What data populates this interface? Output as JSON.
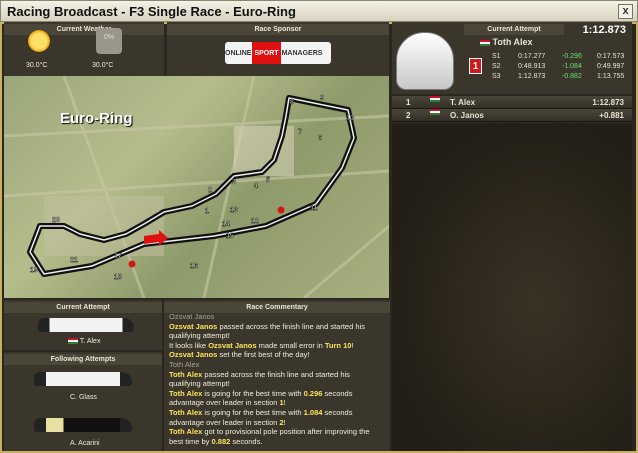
{
  "window": {
    "title": "Racing Broadcast - F3 Single Race - Euro-Ring",
    "close_label": "x"
  },
  "weather": {
    "header": "Current Weather",
    "now_temp": "30.0°C",
    "forecast_pct": "0%",
    "forecast_temp": "30.0°C"
  },
  "sponsor": {
    "header": "Race Sponsor",
    "logo_left": "ONLINE",
    "logo_mid": "SPORT",
    "logo_right": "MANAGERS"
  },
  "map": {
    "track_name": "Euro-Ring",
    "corners": [
      "1",
      "2",
      "3",
      "4",
      "5",
      "6",
      "7",
      "8",
      "9",
      "10",
      "11",
      "12",
      "13",
      "14",
      "15",
      "16",
      "17",
      "18",
      "19",
      "20",
      "21"
    ]
  },
  "current_attempt": {
    "header": "Current Attempt",
    "driver": "Toth Alex",
    "position": "1",
    "time": "1:12.873",
    "sectors": [
      {
        "label": "S1",
        "time": "0:17.277",
        "delta": "-0.296",
        "best": "0:17.573"
      },
      {
        "label": "S2",
        "time": "0:48.913",
        "delta": "-1.084",
        "best": "0:49.997"
      },
      {
        "label": "S3",
        "time": "1:12.873",
        "delta": "-0.882",
        "best": "1:13.755"
      }
    ]
  },
  "standings": [
    {
      "pos": "1",
      "driver": "T. Alex",
      "time": "1:12.873"
    },
    {
      "pos": "2",
      "driver": "O. Janos",
      "time": "+0.881"
    }
  ],
  "current_attempt_small": {
    "header": "Current Attempt",
    "driver": "T. Alex"
  },
  "following": {
    "header": "Following Attempts",
    "drivers": [
      "C. Glass",
      "A. Acarini"
    ]
  },
  "commentary": {
    "header": "Race Commentary",
    "lines": [
      {
        "cls": "hdr",
        "text": "Ozsvat Janos"
      },
      {
        "parts": [
          {
            "hl": "Ozsvat Janos"
          },
          {
            "t": " passed across the finish line and started his qualifying attempt!"
          }
        ]
      },
      {
        "parts": [
          {
            "t": "It looks like "
          },
          {
            "hl": "Ozsvat Janos"
          },
          {
            "t": " made small error in "
          },
          {
            "hl": "Turn 10"
          },
          {
            "t": "!"
          }
        ]
      },
      {
        "parts": [
          {
            "hl": "Ozsvat Janos"
          },
          {
            "t": " set the first best of the day!"
          }
        ]
      },
      {
        "cls": "hdr",
        "text": "Toth Alex"
      },
      {
        "parts": [
          {
            "hl": "Toth Alex"
          },
          {
            "t": " passed across the finish line and started his qualifying attempt!"
          }
        ]
      },
      {
        "parts": [
          {
            "hl": "Toth Alex"
          },
          {
            "t": " is going for the best time with "
          },
          {
            "hl": "0.296"
          },
          {
            "t": " seconds advantage over leader in section "
          },
          {
            "hl": "1"
          },
          {
            "t": "!"
          }
        ]
      },
      {
        "parts": [
          {
            "hl": "Toth Alex"
          },
          {
            "t": " is going for the best time with "
          },
          {
            "hl": "1.084"
          },
          {
            "t": " seconds advantage over leader in section "
          },
          {
            "hl": "2"
          },
          {
            "t": "!"
          }
        ]
      },
      {
        "parts": [
          {
            "hl": "Toth Alex"
          },
          {
            "t": " got to provisional pole position after improving the best time by "
          },
          {
            "hl": "0.882"
          },
          {
            "t": " seconds."
          }
        ]
      }
    ]
  }
}
